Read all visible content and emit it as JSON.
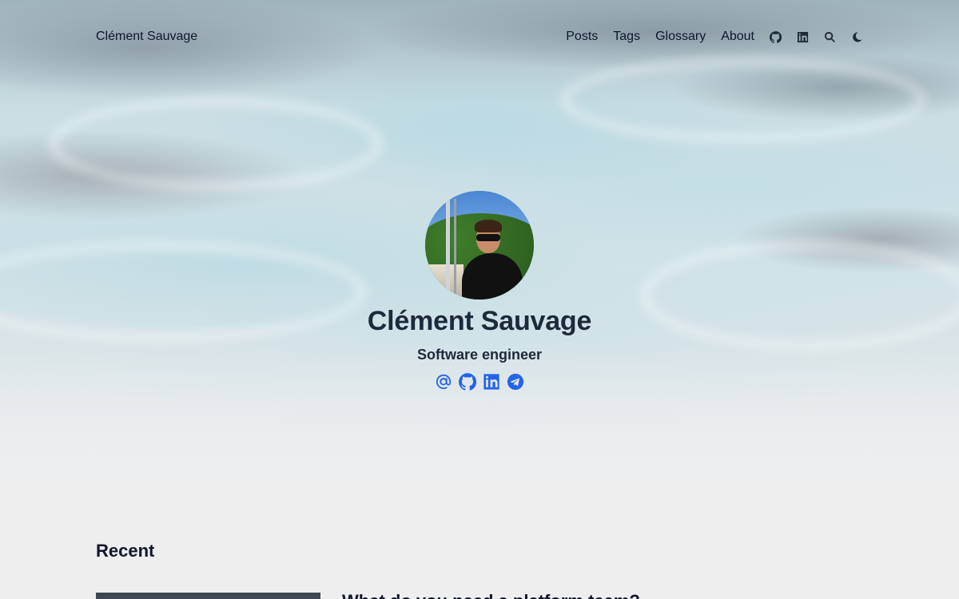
{
  "header": {
    "site_title": "Clément Sauvage",
    "nav": [
      {
        "label": "Posts"
      },
      {
        "label": "Tags"
      },
      {
        "label": "Glossary"
      },
      {
        "label": "About"
      }
    ],
    "icons": [
      "github-icon",
      "linkedin-icon",
      "search-icon",
      "moon-icon"
    ]
  },
  "profile": {
    "name": "Clément Sauvage",
    "subtitle": "Software engineer",
    "socials": [
      "email-icon",
      "github-icon",
      "linkedin-icon",
      "telegram-icon"
    ]
  },
  "recent": {
    "heading": "Recent",
    "first_post_title": "What do you need a platform team?"
  },
  "colors": {
    "text": "#1e293b",
    "accent": "#2563eb"
  }
}
